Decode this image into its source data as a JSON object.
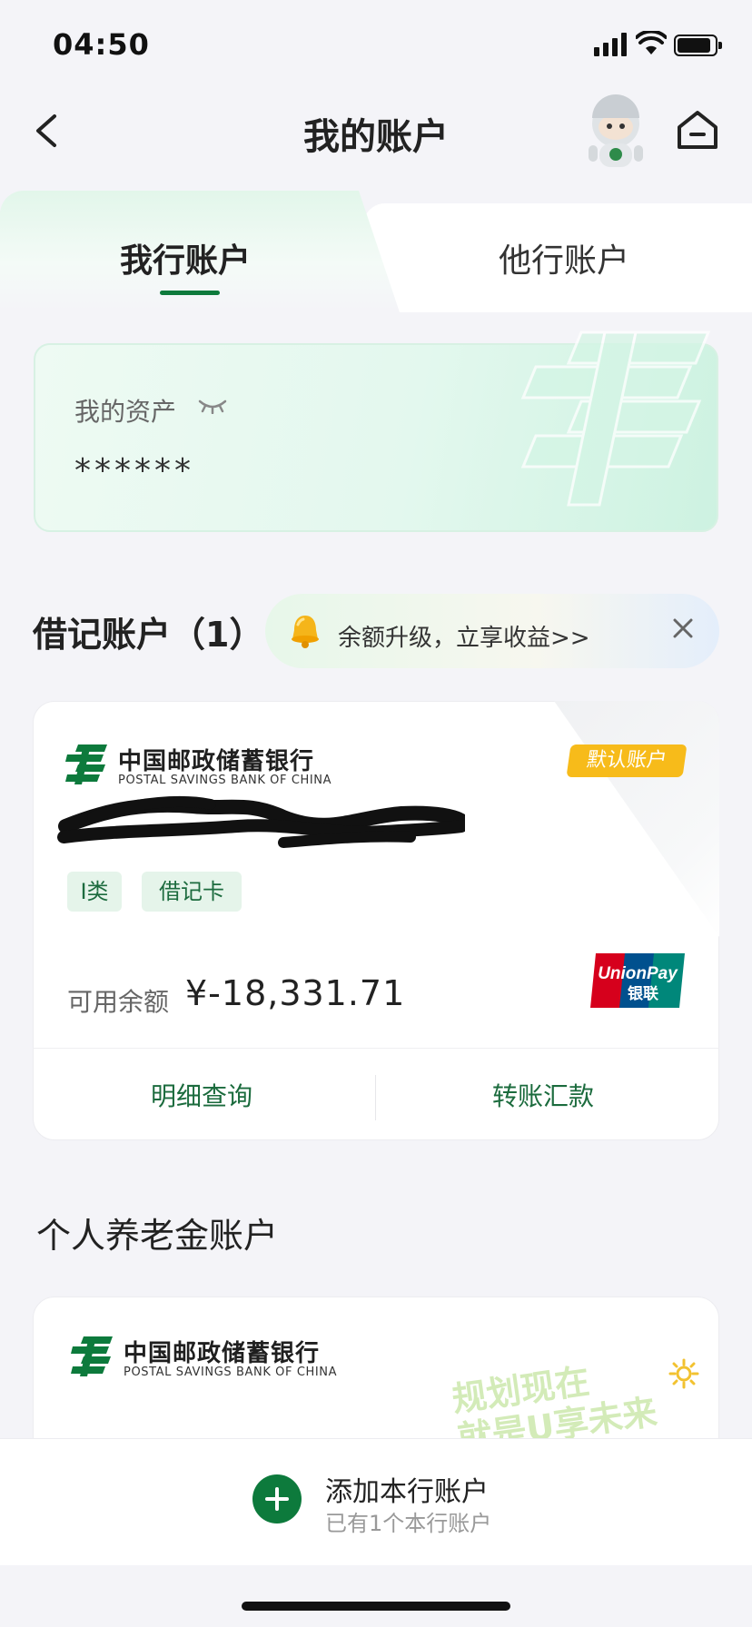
{
  "status_bar": {
    "time": "04:50"
  },
  "nav": {
    "title": "我的账户",
    "back_icon": "chevron-left-icon",
    "home_icon": "home-icon"
  },
  "tabs": [
    {
      "label": "我行账户",
      "active": true
    },
    {
      "label": "他行账户",
      "active": false
    }
  ],
  "assets": {
    "label": "我的资产",
    "value": "******",
    "visibility_icon": "eye-closed-icon"
  },
  "debit": {
    "section_title": "借记账户（1）",
    "promo_text": "余额升级，立享收益>>",
    "card": {
      "bank_name_cn": "中国邮政储蓄银行",
      "bank_name_en": "POSTAL SAVINGS BANK OF CHINA",
      "default_badge": "默认账户",
      "tags": [
        "I类",
        "借记卡"
      ],
      "balance_label": "可用余额",
      "balance_value": "¥-18,331.71",
      "network_logo": "UnionPay 银联",
      "actions": [
        "明细查询",
        "转账汇款"
      ]
    }
  },
  "pension": {
    "section_title": "个人养老金账户",
    "bank_name_cn": "中国邮政储蓄银行",
    "bank_name_en": "POSTAL SAVINGS BANK OF CHINA",
    "slogan_line1": "规划现在",
    "slogan_line2": "就是U享未来"
  },
  "bottom": {
    "add_title": "添加本行账户",
    "add_subtitle": "已有1个本行账户"
  },
  "colors": {
    "brand_green": "#0d7a3c",
    "badge_yellow": "#f7bb1a",
    "unionpay_red": "#d6001c",
    "unionpay_blue": "#00508e",
    "unionpay_teal": "#00877a"
  }
}
